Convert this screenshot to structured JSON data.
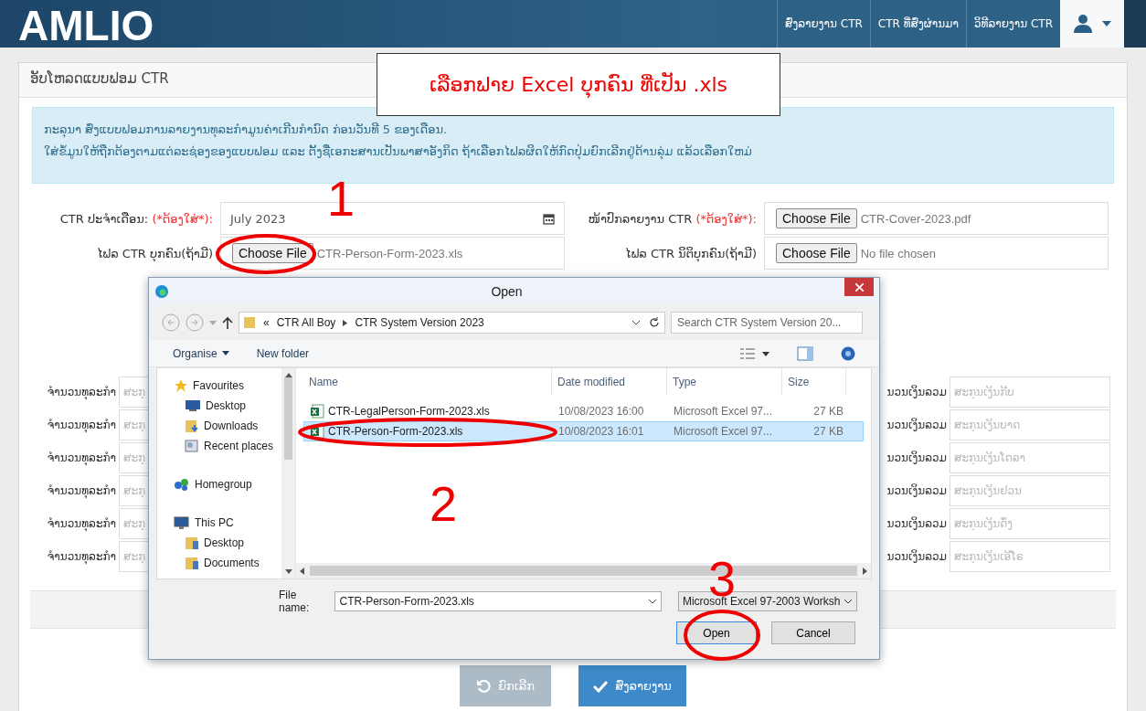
{
  "header": {
    "logo": "AMLIO",
    "nav": [
      "ສົ່ງລາຍງານ CTR",
      "CTR ທີ່ສົ່ງຜ່ານມາ",
      "ວິທີລາຍງານ CTR"
    ]
  },
  "panel": {
    "title": "ອັບໂຫລດແບບຟອມ CTR"
  },
  "callout": {
    "text": "ເລືອກຟາຍ Excel ບຸກຄົນ ທີ່ເປັນ .xls"
  },
  "info": [
    "ກະລຸນາ ສົ່ງແບບຟອມການລາຍງານທຸລະກຳມູນຄ່າເກີນກຳນົດ ກ່ອນວັນທີ 5 ຂອງເດືອນ.",
    "ໃສ່ຂໍ້ມູນໃຫ້ຖືກຕ້ອງຕາມແຕ່ລະຊ່ອງຂອງແບບຟອມ ແລະ ຕັ້ງຊື່ເອກະສານເປັນພາສາອັງກິດ ຖ້າເລືອກໄຟລຜິດໃຫ້ກົດປຸ່ມຍົກເລີກຢູ່ດ້ານລຸ່ມ ແລ້ວເລືອກໃຫມ່"
  ],
  "form": [
    {
      "kind": "date",
      "label": "CTR ປະຈຳເດືອນ:",
      "required": "(*ຕ້ອງໃສ່*):",
      "value": "July  2023"
    },
    {
      "kind": "file",
      "label": "ໜ້າປົກລາຍງານ CTR",
      "required": "(*ຕ້ອງໃສ່*):",
      "button": "Choose File",
      "value": "CTR-Cover-2023.pdf"
    },
    {
      "kind": "file",
      "label": "ໄຟລ CTR ບຸກຄົນ(ຖ້າມີ)",
      "button": "Choose File",
      "value": "CTR-Person-Form-2023.xls"
    },
    {
      "kind": "file",
      "label": "ໄຟລ CTR ນິຕິບຸກຄົນ(ຖ້າມີ)",
      "button": "Choose File",
      "value": "No file chosen"
    }
  ],
  "amounts": [
    {
      "count_label": "ຈຳນວນທຸລະກຳ",
      "count_placeholder": "ສະກຸ",
      "total_label": "ນວນເງິນລວມ",
      "total_placeholder": "ສະກຸນເງິນກີບ"
    },
    {
      "count_label": "ຈຳນວນທຸລະກຳ",
      "count_placeholder": "ສະກຸ",
      "total_label": "ນວນເງິນລວມ",
      "total_placeholder": "ສະກຸນເງິນບາດ"
    },
    {
      "count_label": "ຈຳນວນທຸລະກຳ",
      "count_placeholder": "ສະກຸ",
      "total_label": "ນວນເງິນລວມ",
      "total_placeholder": "ສະກຸນເງິນໂດລາ"
    },
    {
      "count_label": "ຈຳນວນທຸລະກຳ",
      "count_placeholder": "ສະກຸ",
      "total_label": "ນວນເງິນລວມ",
      "total_placeholder": "ສະກຸນເງິນຢວນ"
    },
    {
      "count_label": "ຈຳນວນທຸລະກຳ",
      "count_placeholder": "ສະກຸ",
      "total_label": "ນວນເງິນລວມ",
      "total_placeholder": "ສະກຸນເງິນດົ່ງ"
    },
    {
      "count_label": "ຈຳນວນທຸລະກຳ",
      "count_placeholder": "ສະກຸ",
      "total_label": "ນວນເງິນລວມ",
      "total_placeholder": "ສະກຸນເງິນເອີໂຣ"
    }
  ],
  "buttons": [
    {
      "kind": "reset",
      "label": "ຍົກເລີກ",
      "disabled": true
    },
    {
      "kind": "submit",
      "label": "ສົ່ງລາຍງານ",
      "disabled": false
    }
  ],
  "dialog": {
    "title": "Open",
    "path": [
      "«",
      "CTR All Boy",
      "CTR System Version 2023"
    ],
    "search_placeholder": "Search CTR System Version 20...",
    "toolbar": {
      "organise": "Organise",
      "new_folder": "New folder"
    },
    "nav": [
      {
        "kind": "star",
        "label": "Favourites",
        "children": [
          {
            "kind": "desktop",
            "label": "Desktop"
          },
          {
            "kind": "downloads",
            "label": "Downloads"
          },
          {
            "kind": "recent",
            "label": "Recent places"
          }
        ]
      },
      {
        "kind": "homegroup",
        "label": "Homegroup"
      },
      {
        "kind": "pc",
        "label": "This PC",
        "children": [
          {
            "kind": "folder",
            "label": "Desktop"
          },
          {
            "kind": "folder",
            "label": "Documents"
          }
        ]
      }
    ],
    "columns": [
      "Name",
      "Date modified",
      "Type",
      "Size"
    ],
    "files": [
      {
        "name": "CTR-LegalPerson-Form-2023.xls",
        "date": "10/08/2023 16:00",
        "type": "Microsoft Excel 97...",
        "size": "27 KB",
        "selected": false
      },
      {
        "name": "CTR-Person-Form-2023.xls",
        "date": "10/08/2023 16:01",
        "type": "Microsoft Excel 97...",
        "size": "27 KB",
        "selected": true
      }
    ],
    "file_name_label": "File name:",
    "file_name": "CTR-Person-Form-2023.xls",
    "file_type": "Microsoft Excel 97-2003 Worksh",
    "open": "Open",
    "cancel": "Cancel"
  },
  "annotations": [
    "1",
    "2",
    "3"
  ]
}
